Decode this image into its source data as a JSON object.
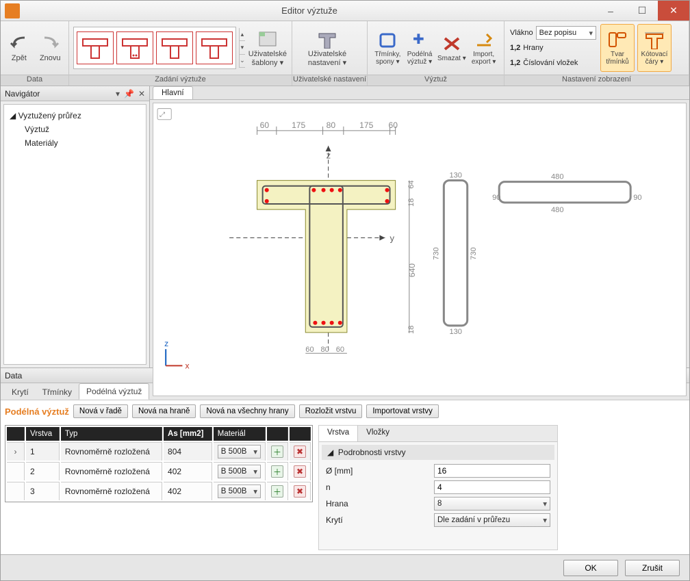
{
  "window": {
    "title": "Editor výztuže"
  },
  "ribbon": {
    "groups": {
      "data": {
        "label": "Data",
        "undo": "Zpět",
        "redo": "Znovu"
      },
      "zadani": {
        "label": "Zadání výztuže",
        "user_templates": "Uživatelské šablony ▾"
      },
      "usersettings": {
        "label": "Uživatelské nastavení",
        "btn": "Uživatelské nastavení ▾"
      },
      "vyztuz": {
        "label": "Výztuž",
        "stirrups": "Třmínky, spony ▾",
        "long": "Podélná výztuž ▾",
        "delete": "Smazat ▾",
        "import": "Import, export ▾"
      },
      "display": {
        "label": "Nastavení zobrazení",
        "fiber": "Vlákno",
        "fiber_val": "Bez popisu",
        "edges_icon": "1,2",
        "edges": "Hrany",
        "numbering_icon": "1,2",
        "numbering": "Číslování vložek",
        "shape": "Tvar třmínků",
        "dimlines": "Kótovací čáry ▾"
      }
    }
  },
  "navigator": {
    "title": "Navigátor",
    "root": "Vyztužený průřez",
    "items": [
      "Výztuž",
      "Materiály"
    ]
  },
  "canvas": {
    "tab": "Hlavní",
    "dims_top": [
      "60",
      "175",
      "80",
      "175",
      "60"
    ],
    "dims_bottom": [
      "60",
      "80",
      "60"
    ],
    "dims_right_inner": [
      "64",
      "18",
      "640",
      "18"
    ],
    "axes": {
      "z": "z",
      "y": "y",
      "x": "x"
    },
    "stirrup1": {
      "w": "130",
      "h": "730"
    },
    "stirrup2": {
      "w": "480",
      "h": "90"
    }
  },
  "dataPanel": {
    "title": "Data",
    "outerTabs": [
      "Krytí",
      "Třmínky",
      "Podélná výztuž"
    ],
    "activeOuter": "Podélná výztuž",
    "section_label": "Podélná výztuž",
    "buttons": [
      "Nová v řadě",
      "Nová na hraně",
      "Nová na všechny hrany",
      "Rozložit vrstvu",
      "Importovat vrstvy"
    ],
    "grid": {
      "headers": [
        "",
        "Vrstva",
        "Typ",
        "As [mm2]",
        "Materiál",
        "",
        ""
      ],
      "rows": [
        {
          "n": "1",
          "typ": "Rovnoměrně rozložená",
          "as": "804",
          "mat": "B 500B"
        },
        {
          "n": "2",
          "typ": "Rovnoměrně rozložená",
          "as": "402",
          "mat": "B 500B"
        },
        {
          "n": "3",
          "typ": "Rovnoměrně rozložená",
          "as": "402",
          "mat": "B 500B"
        }
      ]
    },
    "props": {
      "tabs": [
        "Vrstva",
        "Vložky"
      ],
      "activeTab": "Vrstva",
      "header": "Podrobnosti vrstvy",
      "diameter_label": "Ø  [mm]",
      "diameter": "16",
      "n_label": "n",
      "n": "4",
      "edge_label": "Hrana",
      "edge": "8",
      "cover_label": "Krytí",
      "cover": "Dle zadání v průřezu"
    }
  },
  "dialog": {
    "ok": "OK",
    "cancel": "Zrušit"
  }
}
